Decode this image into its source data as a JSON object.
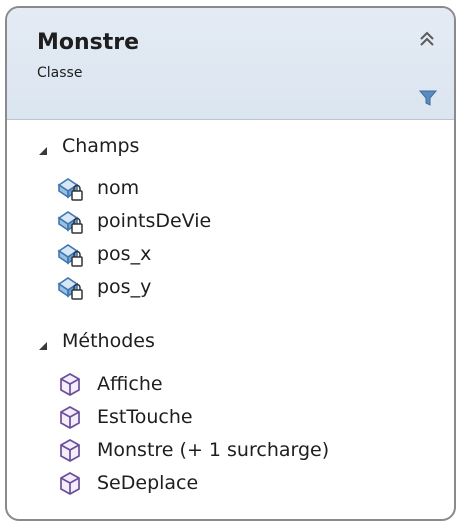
{
  "class": {
    "name": "Monstre",
    "kind": "Classe"
  },
  "fields_section": {
    "label": "Champs",
    "items": [
      {
        "label": "nom",
        "icon": "private-field-icon"
      },
      {
        "label": "pointsDeVie",
        "icon": "private-field-icon"
      },
      {
        "label": "pos_x",
        "icon": "private-field-icon"
      },
      {
        "label": "pos_y",
        "icon": "private-field-icon"
      }
    ]
  },
  "methods_section": {
    "label": "Méthodes",
    "items": [
      {
        "label": "Affiche",
        "icon": "method-icon"
      },
      {
        "label": "EstTouche",
        "icon": "method-icon"
      },
      {
        "label": "Monstre (+ 1 surcharge)",
        "icon": "method-icon"
      },
      {
        "label": "SeDeplace",
        "icon": "method-icon"
      }
    ]
  },
  "colors": {
    "header_bg": "#dde6f1",
    "border": "#8a8a8a",
    "field_icon": "#3c78b4",
    "method_icon": "#6b4e9b",
    "filter_icon": "#4a7fb5"
  }
}
